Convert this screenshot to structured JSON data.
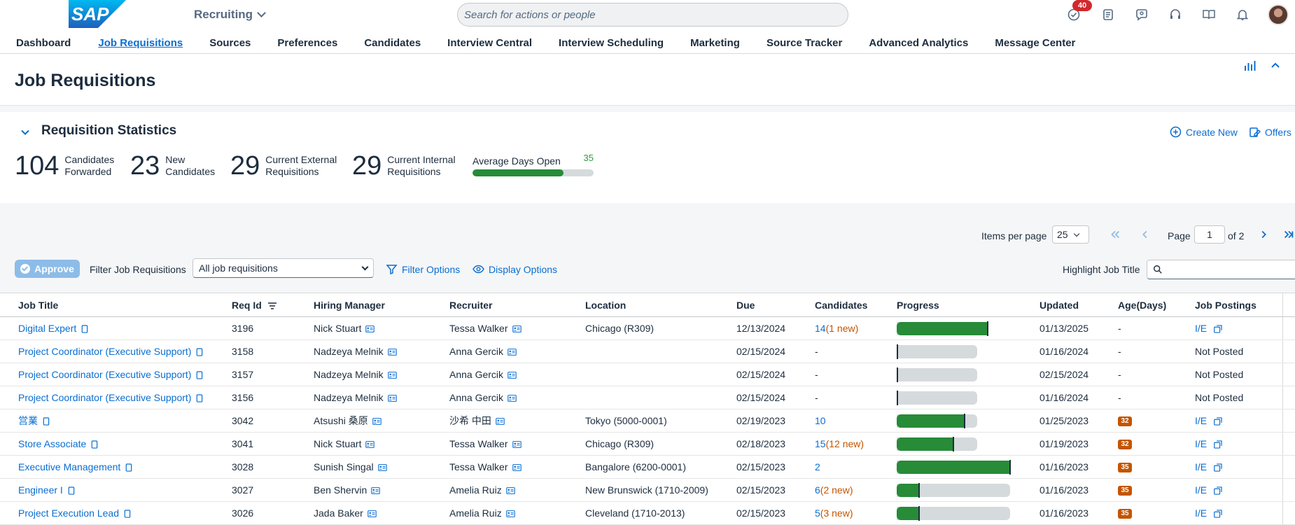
{
  "shell": {
    "logo_text": "SAP",
    "app_title": "Recruiting",
    "search_placeholder": "Search for actions or people",
    "notification_count": "40",
    "icons": [
      "todo-icon",
      "inbox-icon",
      "chat-icon",
      "headset-icon",
      "learning-icon",
      "bell-icon",
      "avatar"
    ]
  },
  "nav": {
    "items": [
      {
        "label": "Dashboard",
        "active": false
      },
      {
        "label": "Job Requisitions",
        "active": true
      },
      {
        "label": "Sources",
        "active": false
      },
      {
        "label": "Preferences",
        "active": false
      },
      {
        "label": "Candidates",
        "active": false
      },
      {
        "label": "Interview Central",
        "active": false
      },
      {
        "label": "Interview Scheduling",
        "active": false
      },
      {
        "label": "Marketing",
        "active": false
      },
      {
        "label": "Source Tracker",
        "active": false
      },
      {
        "label": "Advanced Analytics",
        "active": false
      },
      {
        "label": "Message Center",
        "active": false
      }
    ]
  },
  "page": {
    "title": "Job Requisitions"
  },
  "stats": {
    "title": "Requisition Statistics",
    "kpis": [
      {
        "value": "104",
        "label_line1": "Candidates",
        "label_line2": "Forwarded"
      },
      {
        "value": "23",
        "label_line1": "New",
        "label_line2": "Candidates"
      },
      {
        "value": "29",
        "label_line1": "Current External",
        "label_line2": "Requisitions"
      },
      {
        "value": "29",
        "label_line1": "Current Internal",
        "label_line2": "Requisitions"
      }
    ],
    "avg_days": {
      "label": "Average Days Open",
      "value": "35",
      "fill_fraction": 0.75
    },
    "create_new_label": "Create New",
    "offers_label": "Offers"
  },
  "toolbar": {
    "items_per_page_label": "Items per page",
    "items_per_page_value": "25",
    "page_label": "Page",
    "page_value": "1",
    "page_of": "of 2",
    "approve_label": "Approve",
    "filter_label": "Filter Job Requisitions",
    "filter_value": "All job requisitions",
    "filter_options_label": "Filter Options",
    "display_options_label": "Display Options",
    "highlight_label": "Highlight Job Title"
  },
  "table": {
    "headers": {
      "job_title": "Job Title",
      "req_id": "Req Id",
      "hiring_manager": "Hiring Manager",
      "recruiter": "Recruiter",
      "location": "Location",
      "due": "Due",
      "candidates": "Candidates",
      "progress": "Progress",
      "updated": "Updated",
      "age": "Age(Days)",
      "job_postings": "Job Postings"
    },
    "rows": [
      {
        "title": "Digital Expert",
        "req_id": "3196",
        "manager": "Nick Stuart",
        "recruiter": "Tessa Walker",
        "location": "Chicago (R309)",
        "due": "12/13/2024",
        "cand_count": "14",
        "cand_new": "(1 new)",
        "progress_track": 0.8,
        "progress_fill": 0.8,
        "updated": "01/13/2025",
        "age": "-",
        "age_badge": false,
        "postings": "I/E",
        "posted": true
      },
      {
        "title": "Project Coordinator (Executive Support)",
        "req_id": "3158",
        "manager": "Nadzeya Melnik",
        "recruiter": "Anna Gercik",
        "location": "",
        "due": "02/15/2024",
        "cand_count": "-",
        "cand_new": "",
        "progress_track": 0.71,
        "progress_fill": 0.0,
        "updated": "01/16/2024",
        "age": "-",
        "age_badge": false,
        "postings": "Not Posted",
        "posted": false
      },
      {
        "title": "Project Coordinator (Executive Support)",
        "req_id": "3157",
        "manager": "Nadzeya Melnik",
        "recruiter": "Anna Gercik",
        "location": "",
        "due": "02/15/2024",
        "cand_count": "-",
        "cand_new": "",
        "progress_track": 0.71,
        "progress_fill": 0.0,
        "updated": "02/15/2024",
        "age": "-",
        "age_badge": false,
        "postings": "Not Posted",
        "posted": false
      },
      {
        "title": "Project Coordinator (Executive Support)",
        "req_id": "3156",
        "manager": "Nadzeya Melnik",
        "recruiter": "Anna Gercik",
        "location": "",
        "due": "02/15/2024",
        "cand_count": "-",
        "cand_new": "",
        "progress_track": 0.71,
        "progress_fill": 0.0,
        "updated": "01/16/2024",
        "age": "-",
        "age_badge": false,
        "postings": "Not Posted",
        "posted": false
      },
      {
        "title": "営業",
        "req_id": "3042",
        "manager": "Atsushi 桑原",
        "recruiter": "沙希 中田",
        "location": "Tokyo (5000-0001)",
        "due": "02/19/2023",
        "cand_count": "10",
        "cand_new": "",
        "progress_track": 0.71,
        "progress_fill": 0.6,
        "updated": "01/25/2023",
        "age": "32",
        "age_badge": true,
        "postings": "I/E",
        "posted": true
      },
      {
        "title": "Store Associate",
        "req_id": "3041",
        "manager": "Nick Stuart",
        "recruiter": "Tessa Walker",
        "location": "Chicago (R309)",
        "due": "02/18/2023",
        "cand_count": "15",
        "cand_new": "(12 new)",
        "progress_track": 0.71,
        "progress_fill": 0.5,
        "updated": "01/19/2023",
        "age": "32",
        "age_badge": true,
        "postings": "I/E",
        "posted": true
      },
      {
        "title": "Executive Management",
        "req_id": "3028",
        "manager": "Sunish Singal",
        "recruiter": "Tessa Walker",
        "location": "Bangalore (6200-0001)",
        "due": "02/15/2023",
        "cand_count": "2",
        "cand_new": "",
        "progress_track": 1.0,
        "progress_fill": 1.0,
        "updated": "01/16/2023",
        "age": "35",
        "age_badge": true,
        "postings": "I/E",
        "posted": true
      },
      {
        "title": "Engineer I",
        "req_id": "3027",
        "manager": "Ben Shervin",
        "recruiter": "Amelia Ruiz",
        "location": "New Brunswick (1710-2009)",
        "due": "02/15/2023",
        "cand_count": "6",
        "cand_new": "(2 new)",
        "progress_track": 1.0,
        "progress_fill": 0.2,
        "updated": "01/16/2023",
        "age": "35",
        "age_badge": true,
        "postings": "I/E",
        "posted": true
      },
      {
        "title": "Project Execution Lead",
        "req_id": "3026",
        "manager": "Jada Baker",
        "recruiter": "Amelia Ruiz",
        "location": "Cleveland (1710-2013)",
        "due": "02/15/2023",
        "cand_count": "5",
        "cand_new": "(3 new)",
        "progress_track": 1.0,
        "progress_fill": 0.2,
        "updated": "01/16/2023",
        "age": "35",
        "age_badge": true,
        "postings": "I/E",
        "posted": true
      }
    ]
  },
  "colors": {
    "brand_blue": "#0a6ed1",
    "progress_green": "#278b38",
    "age_orange": "#c35500",
    "badge_red": "#d2282c"
  }
}
